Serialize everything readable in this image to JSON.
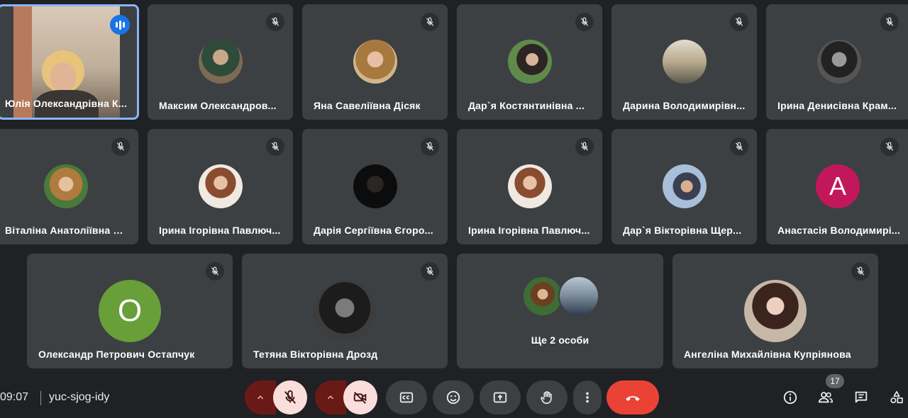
{
  "meeting": {
    "time": "09:07",
    "code": "yuc-sjog-idy",
    "participant_count": "17"
  },
  "row1": [
    {
      "name": "Юлія Олександрівна К..."
    },
    {
      "name": "Максим Олександров..."
    },
    {
      "name": "Яна Савеліївна Дісяк"
    },
    {
      "name": "Дар`я Костянтинівна ..."
    },
    {
      "name": "Дарина Володимирівн..."
    },
    {
      "name": "Ірина Денисівна Крам..."
    }
  ],
  "row2": [
    {
      "name": "Віталіна Анатоліївна Р..."
    },
    {
      "name": "Ірина Ігорівна Павлюч..."
    },
    {
      "name": "Дарія Сергіївна Єгоро..."
    },
    {
      "name": "Ірина Ігорівна Павлюч..."
    },
    {
      "name": "Дар`я Вікторівна Щер..."
    },
    {
      "name": "Анастасія Володимирі...",
      "initial": "А"
    }
  ],
  "row3": [
    {
      "name": "Олександр Петрович Остапчук",
      "initial": "О"
    },
    {
      "name": "Тетяна Вікторівна Дрозд"
    },
    {
      "name": "Ще 2 особи"
    },
    {
      "name": "Ангеліна Михайлівна Купріянова"
    }
  ],
  "colors": {
    "accent_blue": "#1a73e8",
    "end_call": "#ea4335",
    "avatar_magenta": "#c2185b",
    "avatar_green": "#689f38"
  },
  "icons": {
    "mic_off": "mic-off-icon",
    "cam_off": "camera-off-icon",
    "captions": "captions-icon",
    "emoji": "emoji-icon",
    "present": "present-icon",
    "hand": "raise-hand-icon",
    "more": "more-vert-icon",
    "end": "end-call-icon",
    "info": "info-icon",
    "people": "people-icon",
    "chat": "chat-icon",
    "activities": "activities-icon"
  }
}
